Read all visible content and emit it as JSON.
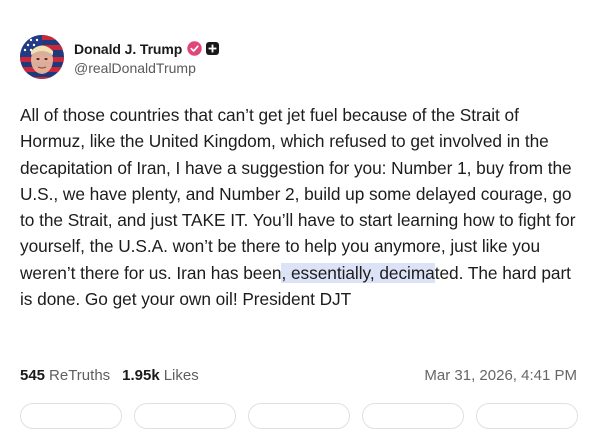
{
  "author": {
    "display_name": "Donald J. Trump",
    "handle": "@realDonaldTrump",
    "avatar_icon": "avatar-flag-portrait",
    "verified_color": "#e0457b"
  },
  "post": {
    "text_before_highlight": "All of those countries that can’t get jet fuel because of the Strait of Hormuz, like the United Kingdom, which refused to get involved in the decapitation of Iran, I have a suggestion for you: Number 1, buy from the U.S., we have plenty, and Number 2, build up some delayed courage, go to the Strait, and just TAKE IT. You’ll have to start learning how to fight for yourself, the U.S.A. won’t be there to help you anymore, just like you weren’t there for us. Iran has been",
    "highlighted_text": ", essentially, decima",
    "text_after_highlight": "ted. The hard part is done. Go get your own oil! President DJT",
    "highlight_color": "#dde3f7"
  },
  "stats": {
    "retruths_count": "545",
    "retruths_label": "ReTruths",
    "likes_count": "1.95k",
    "likes_label": "Likes"
  },
  "timestamp": "Mar 31, 2026, 4:41 PM"
}
